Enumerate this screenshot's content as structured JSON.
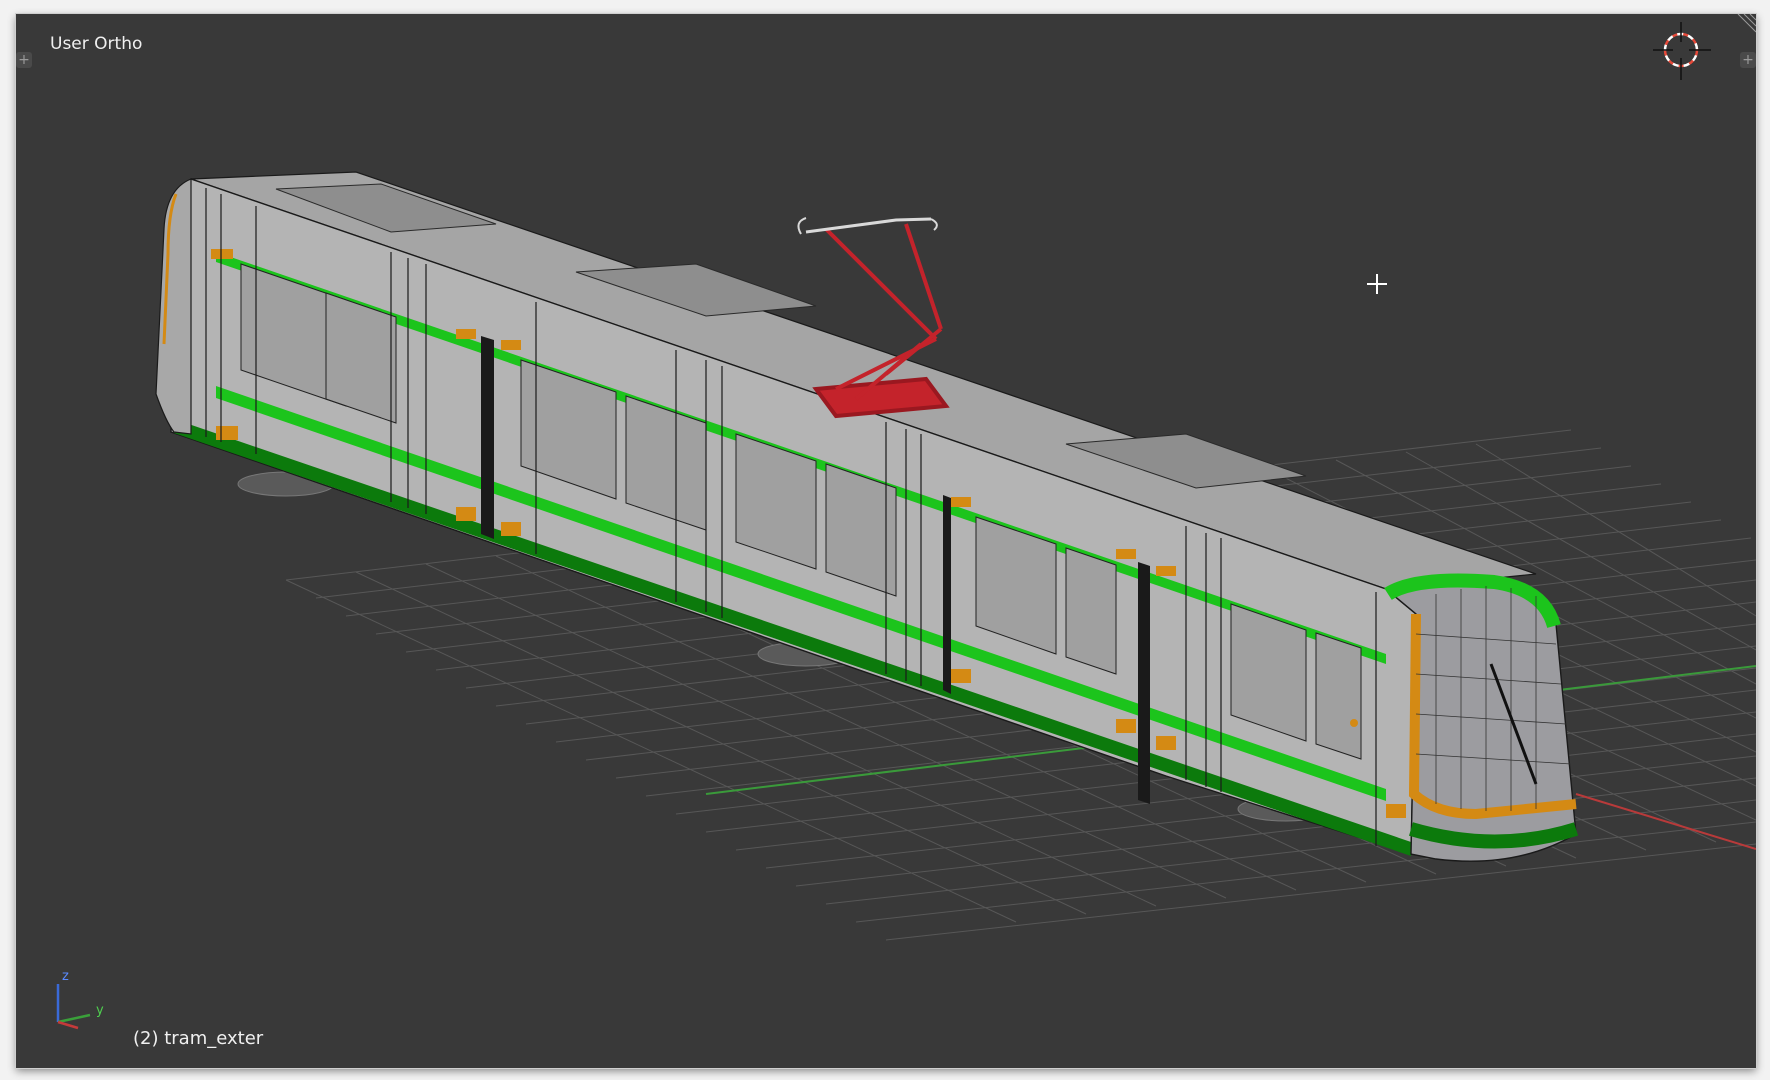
{
  "viewport": {
    "view_label": "User Ortho",
    "object_label": "(2) tram_exter",
    "background_color": "#393939"
  },
  "axes_gizmo": {
    "z": "z",
    "y": "y"
  },
  "icons": {
    "cursor_3d": "3d-cursor-icon",
    "mouse_cursor": "crosshair-cursor-icon",
    "corner_left": "area-split-icon",
    "corner_right": "area-split-icon"
  },
  "colors": {
    "tram_body": "#b4b4b4",
    "tram_roof": "#a9a9a9",
    "tram_stripe": "#1cc41c",
    "tram_dark_green": "#0c7a0c",
    "door_accent": "#d48a14",
    "pantograph": "#c4232b",
    "grid": "#5a5a5a",
    "x_axis": "#c43a3a",
    "y_axis": "#3aa03a"
  }
}
